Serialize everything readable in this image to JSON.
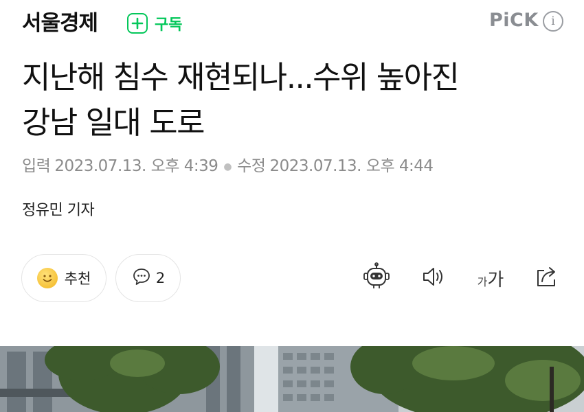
{
  "header": {
    "press_name": "서울경제",
    "subscribe_label": "구독",
    "pick_label": "PiCK",
    "info_label": "i"
  },
  "article": {
    "title_line1": "지난해 침수 재현되나...수위 높아진",
    "title_line2": "강남 일대 도로",
    "meta": {
      "published_label": "입력",
      "published_value": "2023.07.13. 오후 4:39",
      "modified_label": "수정",
      "modified_value": "2023.07.13. 오후 4:44"
    },
    "reporter": "정유민 기자"
  },
  "actions": {
    "like_label": "추천",
    "comment_count": "2",
    "font_small": "가",
    "font_large": "가"
  },
  "colors": {
    "accent_green": "#03c75a",
    "meta_gray": "#8b8b8b",
    "pick_gray": "#8a8d92"
  },
  "icons": [
    "plus-icon",
    "info-icon",
    "smile-emoji-icon",
    "comment-bubble-icon",
    "robot-summary-icon",
    "speaker-icon",
    "font-size-icon",
    "share-icon"
  ]
}
